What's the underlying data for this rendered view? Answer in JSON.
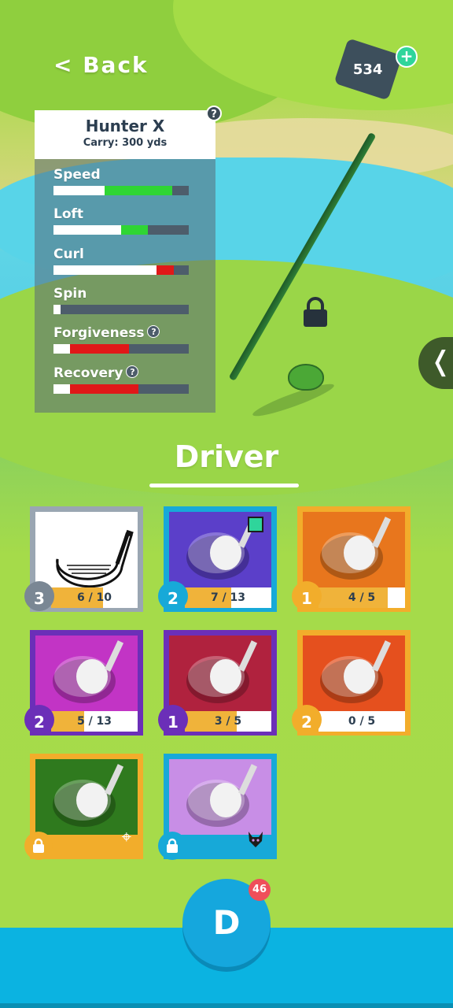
{
  "header": {
    "back_label": "< Back",
    "tickets": "534",
    "add_label": "+"
  },
  "club": {
    "name": "Hunter X",
    "carry": "Carry: 300 yds",
    "help": "?",
    "stats": [
      {
        "label": "Speed",
        "base": 0.38,
        "delta": 0.5,
        "delta_color": "#2fd534",
        "help": false
      },
      {
        "label": "Loft",
        "base": 0.5,
        "delta": 0.2,
        "delta_color": "#2fd534",
        "help": false
      },
      {
        "label": "Curl",
        "base": 0.76,
        "delta": 0.13,
        "delta_color": "#e01818",
        "help": false
      },
      {
        "label": "Spin",
        "base": 0.05,
        "delta": 0.0,
        "delta_color": "#e01818",
        "help": false
      },
      {
        "label": "Forgiveness",
        "base": 0.12,
        "delta": 0.44,
        "delta_color": "#e01818",
        "help": true
      },
      {
        "label": "Recovery",
        "base": 0.12,
        "delta": 0.51,
        "delta_color": "#e01818",
        "help": true
      }
    ]
  },
  "section_title": "Driver",
  "cards": [
    {
      "name": "hunter-x",
      "level": "3",
      "progress": "6 / 10",
      "fill": 0.6,
      "border": "#9aa6b2",
      "badge": "#7a8794",
      "bg": "#ffffff",
      "locked": false
    },
    {
      "name": "dark-driver",
      "level": "2",
      "progress": "7 / 13",
      "fill": 0.54,
      "border": "#17a9d8",
      "badge": "#17a9d8",
      "bg": "#5b3fc9",
      "locked": false,
      "new": true
    },
    {
      "name": "gold-driver",
      "level": "1",
      "progress": "4 / 5",
      "fill": 0.8,
      "border": "#f2ad2b",
      "badge": "#f2ad2b",
      "bg": "#e8761d",
      "locked": false
    },
    {
      "name": "pink-driver",
      "level": "2",
      "progress": "5 / 13",
      "fill": 0.38,
      "border": "#6b2fb8",
      "badge": "#6b2fb8",
      "bg": "#c234c5",
      "locked": false
    },
    {
      "name": "red-driver",
      "level": "1",
      "progress": "3 / 5",
      "fill": 0.6,
      "border": "#6b2fb8",
      "badge": "#6b2fb8",
      "bg": "#b0223e",
      "locked": false
    },
    {
      "name": "orange-driver",
      "level": "2",
      "progress": "0 / 5",
      "fill": 0.0,
      "border": "#f2ad2b",
      "badge": "#f2ad2b",
      "bg": "#e5501e",
      "locked": false
    },
    {
      "name": "green-driver",
      "border": "#f2ad2b",
      "badge": "#f2ad2b",
      "bg": "#2f7a1e",
      "locked": true,
      "icon": "crosshair-icon"
    },
    {
      "name": "purple-driver",
      "border": "#17a9d8",
      "badge": "#17a9d8",
      "bg": "#c88ee6",
      "locked": true,
      "icon": "lynx-icon"
    }
  ],
  "footer": {
    "button_label": "D",
    "badge_count": "46"
  }
}
